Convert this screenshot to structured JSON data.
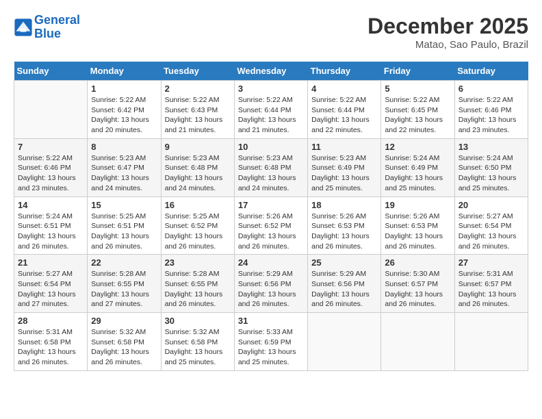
{
  "header": {
    "logo_line1": "General",
    "logo_line2": "Blue",
    "month": "December 2025",
    "location": "Matao, Sao Paulo, Brazil"
  },
  "weekdays": [
    "Sunday",
    "Monday",
    "Tuesday",
    "Wednesday",
    "Thursday",
    "Friday",
    "Saturday"
  ],
  "weeks": [
    [
      {
        "day": "",
        "text": ""
      },
      {
        "day": "1",
        "text": "Sunrise: 5:22 AM\nSunset: 6:42 PM\nDaylight: 13 hours\nand 20 minutes."
      },
      {
        "day": "2",
        "text": "Sunrise: 5:22 AM\nSunset: 6:43 PM\nDaylight: 13 hours\nand 21 minutes."
      },
      {
        "day": "3",
        "text": "Sunrise: 5:22 AM\nSunset: 6:44 PM\nDaylight: 13 hours\nand 21 minutes."
      },
      {
        "day": "4",
        "text": "Sunrise: 5:22 AM\nSunset: 6:44 PM\nDaylight: 13 hours\nand 22 minutes."
      },
      {
        "day": "5",
        "text": "Sunrise: 5:22 AM\nSunset: 6:45 PM\nDaylight: 13 hours\nand 22 minutes."
      },
      {
        "day": "6",
        "text": "Sunrise: 5:22 AM\nSunset: 6:46 PM\nDaylight: 13 hours\nand 23 minutes."
      }
    ],
    [
      {
        "day": "7",
        "text": "Sunrise: 5:22 AM\nSunset: 6:46 PM\nDaylight: 13 hours\nand 23 minutes."
      },
      {
        "day": "8",
        "text": "Sunrise: 5:23 AM\nSunset: 6:47 PM\nDaylight: 13 hours\nand 24 minutes."
      },
      {
        "day": "9",
        "text": "Sunrise: 5:23 AM\nSunset: 6:48 PM\nDaylight: 13 hours\nand 24 minutes."
      },
      {
        "day": "10",
        "text": "Sunrise: 5:23 AM\nSunset: 6:48 PM\nDaylight: 13 hours\nand 24 minutes."
      },
      {
        "day": "11",
        "text": "Sunrise: 5:23 AM\nSunset: 6:49 PM\nDaylight: 13 hours\nand 25 minutes."
      },
      {
        "day": "12",
        "text": "Sunrise: 5:24 AM\nSunset: 6:49 PM\nDaylight: 13 hours\nand 25 minutes."
      },
      {
        "day": "13",
        "text": "Sunrise: 5:24 AM\nSunset: 6:50 PM\nDaylight: 13 hours\nand 25 minutes."
      }
    ],
    [
      {
        "day": "14",
        "text": "Sunrise: 5:24 AM\nSunset: 6:51 PM\nDaylight: 13 hours\nand 26 minutes."
      },
      {
        "day": "15",
        "text": "Sunrise: 5:25 AM\nSunset: 6:51 PM\nDaylight: 13 hours\nand 26 minutes."
      },
      {
        "day": "16",
        "text": "Sunrise: 5:25 AM\nSunset: 6:52 PM\nDaylight: 13 hours\nand 26 minutes."
      },
      {
        "day": "17",
        "text": "Sunrise: 5:26 AM\nSunset: 6:52 PM\nDaylight: 13 hours\nand 26 minutes."
      },
      {
        "day": "18",
        "text": "Sunrise: 5:26 AM\nSunset: 6:53 PM\nDaylight: 13 hours\nand 26 minutes."
      },
      {
        "day": "19",
        "text": "Sunrise: 5:26 AM\nSunset: 6:53 PM\nDaylight: 13 hours\nand 26 minutes."
      },
      {
        "day": "20",
        "text": "Sunrise: 5:27 AM\nSunset: 6:54 PM\nDaylight: 13 hours\nand 26 minutes."
      }
    ],
    [
      {
        "day": "21",
        "text": "Sunrise: 5:27 AM\nSunset: 6:54 PM\nDaylight: 13 hours\nand 27 minutes."
      },
      {
        "day": "22",
        "text": "Sunrise: 5:28 AM\nSunset: 6:55 PM\nDaylight: 13 hours\nand 27 minutes."
      },
      {
        "day": "23",
        "text": "Sunrise: 5:28 AM\nSunset: 6:55 PM\nDaylight: 13 hours\nand 26 minutes."
      },
      {
        "day": "24",
        "text": "Sunrise: 5:29 AM\nSunset: 6:56 PM\nDaylight: 13 hours\nand 26 minutes."
      },
      {
        "day": "25",
        "text": "Sunrise: 5:29 AM\nSunset: 6:56 PM\nDaylight: 13 hours\nand 26 minutes."
      },
      {
        "day": "26",
        "text": "Sunrise: 5:30 AM\nSunset: 6:57 PM\nDaylight: 13 hours\nand 26 minutes."
      },
      {
        "day": "27",
        "text": "Sunrise: 5:31 AM\nSunset: 6:57 PM\nDaylight: 13 hours\nand 26 minutes."
      }
    ],
    [
      {
        "day": "28",
        "text": "Sunrise: 5:31 AM\nSunset: 6:58 PM\nDaylight: 13 hours\nand 26 minutes."
      },
      {
        "day": "29",
        "text": "Sunrise: 5:32 AM\nSunset: 6:58 PM\nDaylight: 13 hours\nand 26 minutes."
      },
      {
        "day": "30",
        "text": "Sunrise: 5:32 AM\nSunset: 6:58 PM\nDaylight: 13 hours\nand 25 minutes."
      },
      {
        "day": "31",
        "text": "Sunrise: 5:33 AM\nSunset: 6:59 PM\nDaylight: 13 hours\nand 25 minutes."
      },
      {
        "day": "",
        "text": ""
      },
      {
        "day": "",
        "text": ""
      },
      {
        "day": "",
        "text": ""
      }
    ]
  ]
}
